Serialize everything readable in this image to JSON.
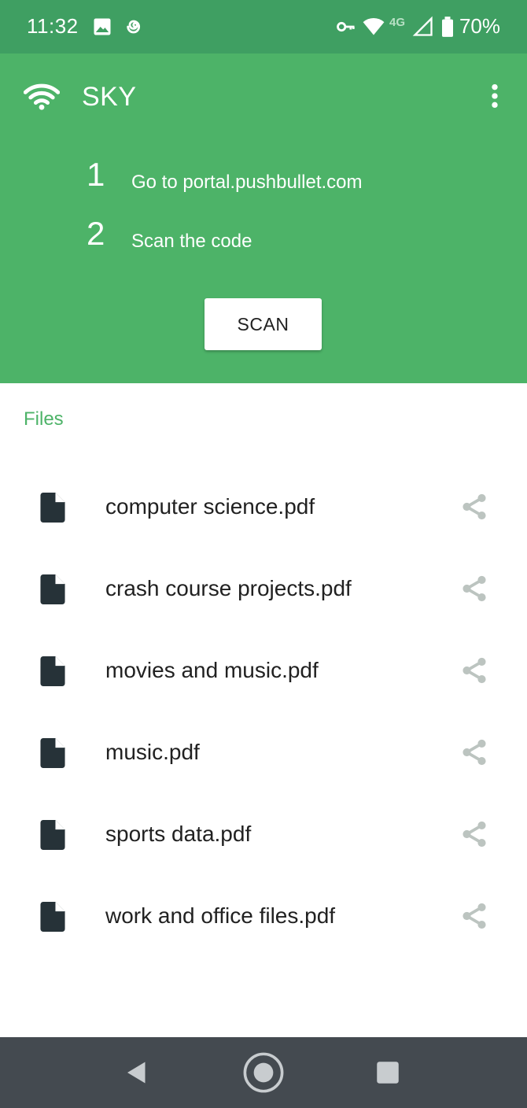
{
  "status_bar": {
    "time": "11:32",
    "network_label": "4G",
    "battery": "70%",
    "icons": [
      "image-icon",
      "spiral-icon",
      "key-icon",
      "wifi-signal-icon",
      "cell-signal-icon",
      "battery-icon"
    ]
  },
  "header": {
    "title": "SKY",
    "steps": [
      {
        "number": "1",
        "text": "Go to portal.pushbullet.com"
      },
      {
        "number": "2",
        "text": "Scan the code"
      }
    ],
    "scan_label": "SCAN"
  },
  "files": {
    "heading": "Files",
    "items": [
      {
        "name": "computer science.pdf"
      },
      {
        "name": "crash course projects.pdf"
      },
      {
        "name": "movies and music.pdf"
      },
      {
        "name": "music.pdf"
      },
      {
        "name": "sports data.pdf"
      },
      {
        "name": "work and office files.pdf"
      }
    ]
  },
  "colors": {
    "status_bar": "#3f9f62",
    "header": "#4db368",
    "accent": "#4db368",
    "share_icon": "#bcc4c0",
    "nav_bar": "#444a50"
  }
}
